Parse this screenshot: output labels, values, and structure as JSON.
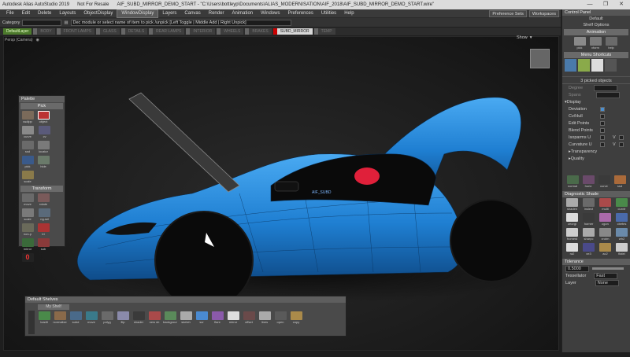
{
  "window": {
    "app_title": "Autodesk Alias AutoStudio 2019",
    "license": "Not For Resale",
    "file_title": "AIF_SUBD_MIRROR_DEMO_START - \"C:\\Users\\bottleyp\\Documents\\ALIAS_MODERNISATION\\AIF_2018\\AIF_SUBD_MIRROR_DEMO_START.wire\"",
    "controls": [
      "—",
      "❐",
      "✕"
    ]
  },
  "menubar": {
    "items": [
      "File",
      "Edit",
      "Delete",
      "Layouts",
      "ObjectDisplay",
      "WindowDisplay",
      "Layers",
      "Canvas",
      "Render",
      "Animation",
      "Windows",
      "Preferences",
      "Utilities",
      "Help"
    ],
    "active_index": 5,
    "right_buttons": [
      "Preference Sets",
      "Workspaces"
    ]
  },
  "toolbar2": {
    "category_label": "Category",
    "category_value": "",
    "hint": "Dec module or select name of item to pick /unpick  [Left Toggle | Middle Add | Right Unpick]"
  },
  "layers": [
    "DefaultLayer",
    "BODY",
    "FRONT LAMPS",
    "GLASS",
    "DETAILS",
    "REAR LAMPS",
    "INTERIOR",
    "WHEELS",
    "BRAKES",
    "SUBD_MIRROR",
    "TEMP"
  ],
  "viewport": {
    "label": "Persp (Camera)",
    "show_label": "Show",
    "watermark": "AIF_SUBD"
  },
  "palette": {
    "title": "Palette",
    "sections": [
      {
        "name": "Pick",
        "tools": [
          "ssdlpp",
          "object",
          "curve",
          "cv",
          "ssd",
          "locator",
          "pick",
          "hide",
          "scale"
        ]
      },
      {
        "name": "Transform",
        "tools": [
          "move",
          "rotate",
          "scale",
          "ng-sel",
          "non-p",
          "tri",
          "mirror",
          "sub",
          "0"
        ]
      }
    ]
  },
  "shelves": {
    "title": "Default Shelves",
    "tab": "My Shelf",
    "items": [
      "loadit",
      "normalize",
      "subd",
      "move",
      "polyg",
      "flip",
      "shader",
      "new sh",
      "background",
      "sketch",
      "scr",
      "flare",
      "mirror",
      "offset",
      "lines",
      "open",
      "copy"
    ]
  },
  "control_panel": {
    "title": "Control Panel",
    "default_label": "Default",
    "shelf_options": "Shelf Options",
    "mode_section": "Animation",
    "mode_tools": [
      "pick",
      "xform",
      "help"
    ],
    "menu_shortcuts": "Menu Shortcuts",
    "selection": "3 picked objects",
    "degree_label": "Degree",
    "spans_label": "Spans",
    "display_label": "Display",
    "display_rows": [
      {
        "label": "Deviation",
        "on": true
      },
      {
        "label": "Cv/Hull",
        "on": false
      },
      {
        "label": "Edit Points",
        "on": false
      },
      {
        "label": "Blend Points",
        "on": false
      },
      {
        "label": "Isoparms U",
        "on": false,
        "suffix": "V"
      },
      {
        "label": "Curvature U",
        "on": false,
        "suffix": "V"
      }
    ],
    "transparency": "Transparency",
    "quality": "Quality",
    "eval_tools": [
      "normal",
      "horiz",
      "curve",
      "ssd"
    ],
    "diagnostic_title": "Diagnostic Shade",
    "diagnostic_tools": [
      "shaden",
      "inslect",
      "multi",
      "curvtr",
      "zeorgi",
      "horner",
      "cgon",
      "cbetes",
      "fromest",
      "sharpc",
      "xrotm",
      "wh2",
      "ra2",
      "xe3",
      "ac2",
      "flatei"
    ],
    "tolerance_label": "Tolerance",
    "tolerance_value": "0.5000",
    "tessellator_label": "Tessellator",
    "tessellator_value": "Fast",
    "layer_label": "Layer",
    "layer_value": "None"
  },
  "colors": {
    "car_body": "#2a8de0",
    "accent_blue": "#4a8fd0",
    "seat_red": "#e0203a"
  }
}
